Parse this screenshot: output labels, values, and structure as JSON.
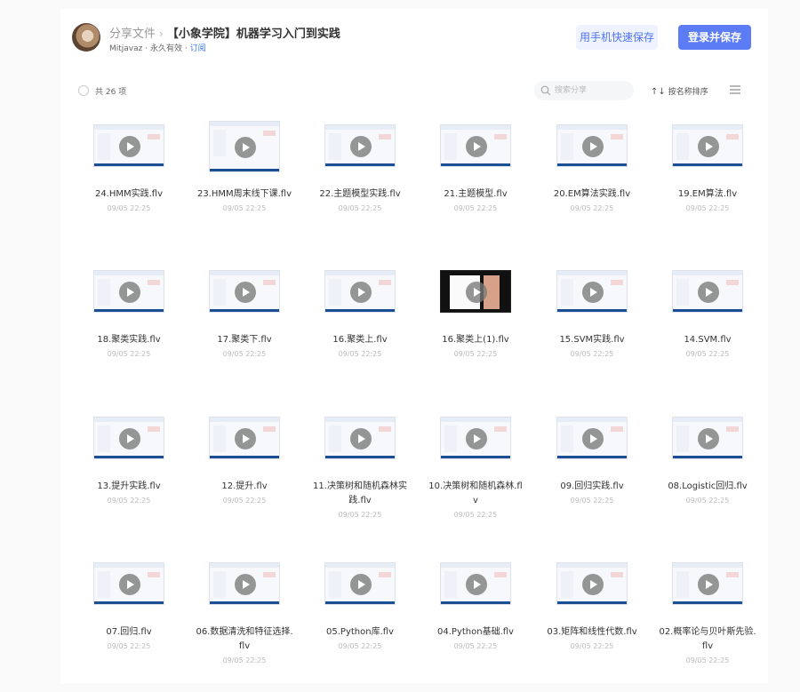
{
  "header": {
    "breadcrumb_root": "分享文件",
    "breadcrumb_sep": "›",
    "title": "【小象学院】机器学习入门到实践",
    "owner": "Mitjavaz",
    "meta_sep": " · ",
    "validity": "永久有效",
    "subscribe": "订阅",
    "phone_save_button": "用手机快速保存",
    "login_save_button": "登录并保存"
  },
  "toolbar": {
    "count_label": "共 26 项",
    "search_placeholder": "搜索分享",
    "sort_icon": "↑↓",
    "sort_label": "按名称排序"
  },
  "files": [
    {
      "name": "24.HMM实践.flv",
      "date": "09/05 22:25"
    },
    {
      "name": "23.HMM周末线下课.flv",
      "date": "09/05 22:25"
    },
    {
      "name": "22.主题模型实践.flv",
      "date": "09/05 22:25"
    },
    {
      "name": "21.主题模型.flv",
      "date": "09/05 22:25"
    },
    {
      "name": "20.EM算法实践.flv",
      "date": "09/05 22:25"
    },
    {
      "name": "19.EM算法.flv",
      "date": "09/05 22:25"
    },
    {
      "name": "18.聚类实践.flv",
      "date": "09/05 22:25"
    },
    {
      "name": "17.聚类下.flv",
      "date": "09/05 22:25"
    },
    {
      "name": "16.聚类上.flv",
      "date": "09/05 22:25"
    },
    {
      "name": "16.聚类上(1).flv",
      "date": "09/05 22:25"
    },
    {
      "name": "15.SVM实践.flv",
      "date": "09/05 22:25"
    },
    {
      "name": "14.SVM.flv",
      "date": "09/05 22:25"
    },
    {
      "name": "13.提升实践.flv",
      "date": "09/05 22:25"
    },
    {
      "name": "12.提升.flv",
      "date": "09/05 22:25"
    },
    {
      "name": "11.决策树和随机森林实践.flv",
      "date": "09/05 22:25"
    },
    {
      "name": "10.决策树和随机森林.flv",
      "date": "09/05 22:25"
    },
    {
      "name": "09.回归实践.flv",
      "date": "09/05 22:25"
    },
    {
      "name": "08.Logistic回归.flv",
      "date": "09/05 22:25"
    },
    {
      "name": "07.回归.flv",
      "date": "09/05 22:25"
    },
    {
      "name": "06.数据清洗和特征选择.flv",
      "date": "09/05 22:25"
    },
    {
      "name": "05.Python库.flv",
      "date": "09/05 22:25"
    },
    {
      "name": "04.Python基础.flv",
      "date": "09/05 22:25"
    },
    {
      "name": "03.矩阵和线性代数.flv",
      "date": "09/05 22:25"
    },
    {
      "name": "02.概率论与贝叶斯先验.flv",
      "date": "09/05 22:25"
    }
  ],
  "colors": {
    "accent": "#5b7cf5",
    "link": "#3b7bff",
    "phone_button_bg": "#eef3ff"
  },
  "icons": {
    "search": "search-icon",
    "sort": "sort-icon",
    "list_view": "list-view-icon",
    "play": "play-icon"
  }
}
